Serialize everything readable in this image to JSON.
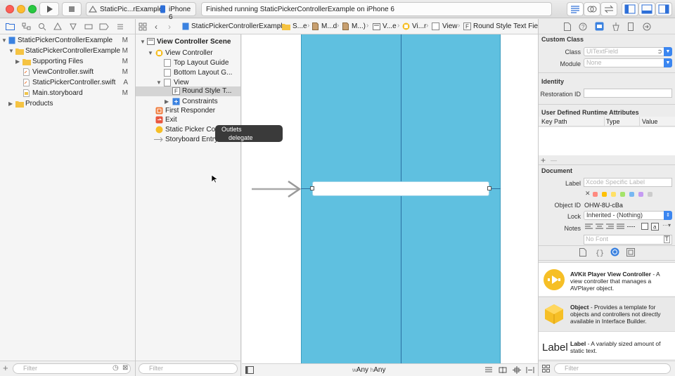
{
  "toolbar": {
    "scheme_name": "StaticPic...rExample",
    "device": "iPhone 6",
    "status": "Finished running StaticPickerControllerExample on iPhone 6"
  },
  "navigator": {
    "files": [
      {
        "label": "StaticPickerControllerExample",
        "badge": "M"
      },
      {
        "label": "StaticPickerControllerExample",
        "badge": "M"
      },
      {
        "label": "Supporting Files",
        "badge": "M"
      },
      {
        "label": "ViewController.swift",
        "badge": "M"
      },
      {
        "label": "StaticPickerController.swift",
        "badge": "A"
      },
      {
        "label": "Main.storyboard",
        "badge": "M"
      },
      {
        "label": "Products",
        "badge": ""
      }
    ],
    "filter_placeholder": "Filter"
  },
  "jumpbar": {
    "items": [
      "StaticPickerControllerExample",
      "S...e",
      "M...d",
      "M...)",
      "V...e",
      "Vi...r",
      "View",
      "Round Style Text Field"
    ]
  },
  "outline": {
    "scene": "View Controller Scene",
    "items": [
      "View Controller",
      "Top Layout Guide",
      "Bottom Layout G...",
      "View",
      "Round Style T...",
      "Constraints",
      "First Responder",
      "Exit",
      "Static Picker Contr",
      "Storyboard Entry P"
    ],
    "filter_placeholder": "Filter"
  },
  "tooltip": {
    "title": "Outlets",
    "item": "delegate"
  },
  "canvas": {
    "size_class_w_prefix": "w",
    "size_class_w": "Any",
    "size_class_h_prefix": "h",
    "size_class_h": "Any",
    "scene_color": "#5fc0e0"
  },
  "inspector": {
    "custom_class": {
      "header": "Custom Class",
      "class_label": "Class",
      "class_placeholder": "UITextField",
      "module_label": "Module",
      "module_placeholder": "None"
    },
    "identity": {
      "header": "Identity",
      "restoration_label": "Restoration ID"
    },
    "runtime": {
      "header": "User Defined Runtime Attributes",
      "col_keypath": "Key Path",
      "col_type": "Type",
      "col_value": "Value",
      "add": "+",
      "remove": "—"
    },
    "document": {
      "header": "Document",
      "label_label": "Label",
      "label_placeholder": "Xcode Specific Label",
      "object_id_label": "Object ID",
      "object_id": "OHW-8U-cBa",
      "lock_label": "Lock",
      "lock_value": "Inherited - (Nothing)",
      "notes_label": "Notes",
      "font_placeholder": "No Font",
      "swatches": [
        "#ff8a80",
        "#ffc107",
        "#ffe066",
        "#a4e36a",
        "#78b8f2",
        "#c59bf2",
        "#cccccc"
      ]
    },
    "library": [
      {
        "title": "AVKit Player View Controller",
        "desc": " - A view controller that manages a AVPlayer object."
      },
      {
        "title": "Object",
        "desc": " - Provides a template for objects and controllers not directly available in Interface Builder."
      },
      {
        "title": "Label",
        "desc": " - A variably sized amount of static text.",
        "icon_text": "Label"
      }
    ],
    "filter_placeholder": "Filter"
  }
}
